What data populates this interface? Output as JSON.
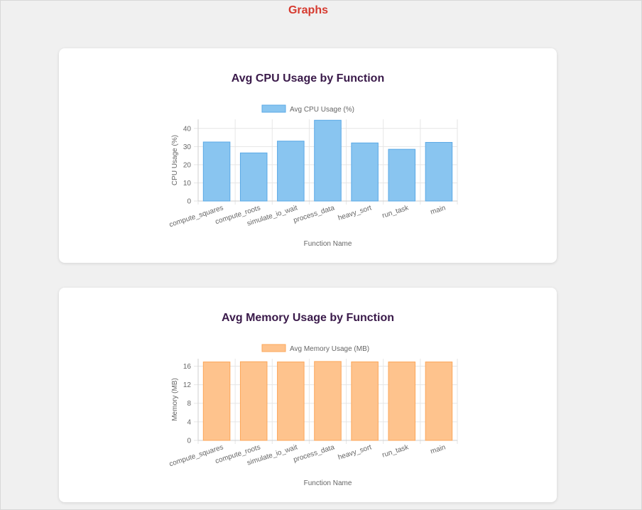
{
  "page": {
    "title": "Graphs"
  },
  "colors": {
    "title": "#d63a2f",
    "card_title": "#3a1a4a",
    "cpu_fill": "#89c5f0",
    "cpu_stroke": "#5aa9e6",
    "mem_fill": "#fec38d",
    "mem_stroke": "#fca75a"
  },
  "chart_data": [
    {
      "type": "bar",
      "title": "Avg CPU Usage by Function",
      "xlabel": "Function Name",
      "ylabel": "CPU Usage (%)",
      "categories": [
        "compute_squares",
        "compute_roots",
        "simulate_io_wait",
        "process_data",
        "heavy_sort",
        "run_task",
        "main"
      ],
      "series": [
        {
          "name": "Avg CPU Usage (%)",
          "values": [
            32.5,
            26.5,
            33,
            44.5,
            32,
            28.5,
            32.3
          ]
        }
      ],
      "ylim": [
        0,
        45
      ],
      "yticks": [
        0,
        10,
        20,
        30,
        40
      ],
      "grid": true,
      "legend": "top-center"
    },
    {
      "type": "bar",
      "title": "Avg Memory Usage by Function",
      "xlabel": "Function Name",
      "ylabel": "Memory (MB)",
      "categories": [
        "compute_squares",
        "compute_roots",
        "simulate_io_wait",
        "process_data",
        "heavy_sort",
        "run_task",
        "main"
      ],
      "series": [
        {
          "name": "Avg Memory Usage (MB)",
          "values": [
            16.9,
            16.95,
            16.9,
            17.0,
            16.92,
            16.9,
            16.9
          ]
        }
      ],
      "ylim": [
        0,
        17.6
      ],
      "yticks": [
        0,
        4,
        8,
        12,
        16
      ],
      "grid": true,
      "legend": "top-center"
    }
  ]
}
